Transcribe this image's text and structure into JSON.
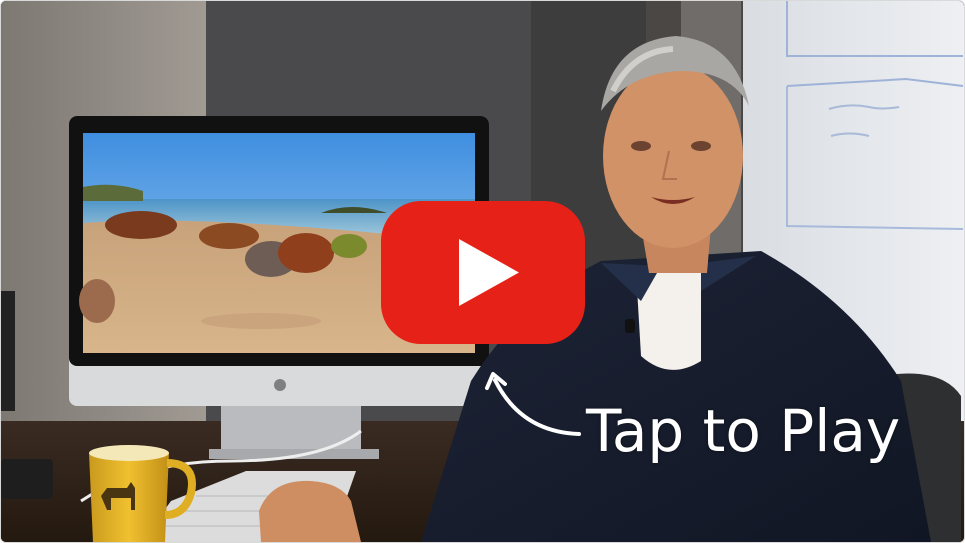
{
  "video": {
    "cta_label": "Tap to Play",
    "play_button_color": "#e62117",
    "play_icon_color": "#ffffff"
  },
  "icons": {
    "play": "play-icon",
    "arrow": "curved-arrow-icon",
    "apple_logo": "apple-logo-icon"
  }
}
